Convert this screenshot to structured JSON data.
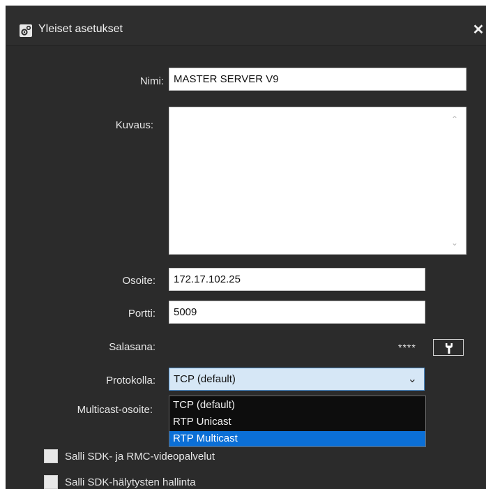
{
  "window": {
    "title": "Yleiset asetukset",
    "close_glyph": "✕",
    "title_icon": "settings-gears-icon",
    "close_icon": "close-icon"
  },
  "form": {
    "name_label": "Nimi:",
    "name_value": "MASTER SERVER V9",
    "description_label": "Kuvaus:",
    "description_value": "",
    "address_label": "Osoite:",
    "address_value": "172.17.102.25",
    "port_label": "Portti:",
    "port_value": "5009",
    "password_label": "Salasana:",
    "password_mask": "****",
    "password_button_icon": "key-icon",
    "protocol_label": "Protokolla:",
    "protocol_selected": "TCP (default)",
    "protocol_options": [
      "TCP (default)",
      "RTP Unicast",
      "RTP Multicast"
    ],
    "protocol_highlighted_option": "RTP Multicast",
    "multicast_label": "Multicast-osoite:"
  },
  "checkboxes": [
    {
      "label": "Salli SDK- ja RMC-videopalvelut",
      "checked": false
    },
    {
      "label": "Salli SDK-hälytysten hallinta",
      "checked": false
    }
  ],
  "colors": {
    "dialog_background": "#2b2b2b",
    "selection_highlight": "#0b6fd6",
    "select_background": "#d6e7f6"
  }
}
